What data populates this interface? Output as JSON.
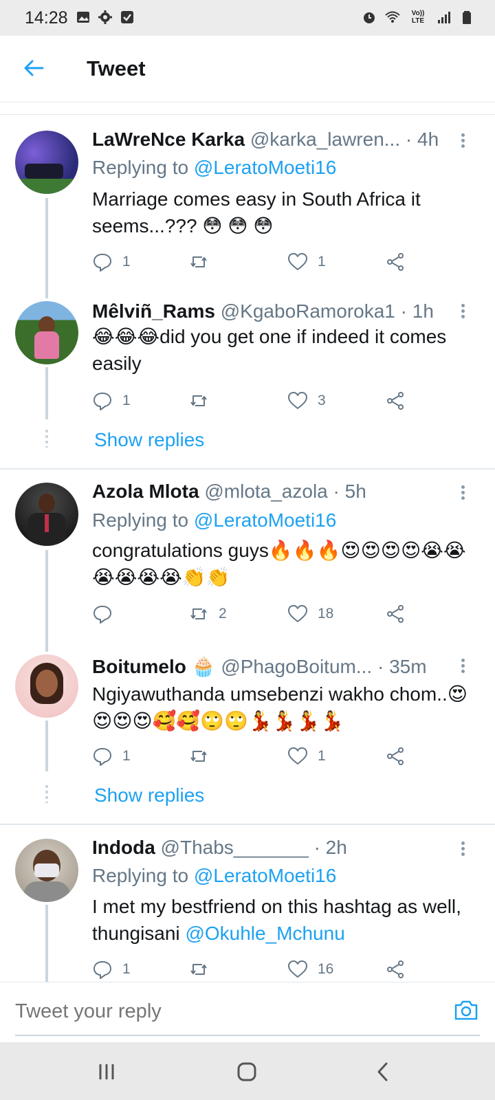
{
  "status_bar": {
    "time": "14:28",
    "network": "Vo)) LTE"
  },
  "app_bar": {
    "title": "Tweet"
  },
  "tweets": [
    {
      "name": "LaWreNce Karka",
      "handle": "@karka_lawren...",
      "time": "· 4h",
      "replying_prefix": "Replying to ",
      "replying_to": "@LeratoMoeti16",
      "text": "Marriage comes easy in South Africa it seems...??? 😳 😳 😳",
      "replies": "1",
      "retweets": "",
      "likes": "1"
    },
    {
      "name": "Mêlviñ_Rams",
      "handle": "@KgaboRamoroka1",
      "time": "· 1h",
      "text": "😂😂😂did  you get one if indeed it comes easily",
      "replies": "1",
      "retweets": "",
      "likes": "3",
      "show_replies": "Show replies"
    },
    {
      "name": "Azola Mlota",
      "handle": "@mlota_azola",
      "time": "· 5h",
      "replying_prefix": "Replying to ",
      "replying_to": "@LeratoMoeti16",
      "text": "congratulations guys🔥🔥🔥😍😍😍😍😭😭😭😭😭😭👏👏",
      "replies": "",
      "retweets": "2",
      "likes": "18"
    },
    {
      "name": "Boitumelo 🧁",
      "handle": "@PhagoBoitum...",
      "time": "· 35m",
      "text": "Ngiyawuthanda umsebenzi wakho chom..😍😍😍😍🥰🥰🙄🙄💃💃💃💃",
      "replies": "1",
      "retweets": "",
      "likes": "1",
      "show_replies": "Show replies"
    },
    {
      "name": "Indoda",
      "handle": "@Thabs_______",
      "time": "· 2h",
      "replying_prefix": "Replying to ",
      "replying_to": "@LeratoMoeti16",
      "text_prefix": "I met my bestfriend on this hashtag as well, thungisani ",
      "mention": "@Okuhle_Mchunu",
      "replies": "1",
      "retweets": "",
      "likes": "16"
    }
  ],
  "reply_bar": {
    "placeholder": "Tweet your reply"
  },
  "icons": {
    "back": "arrow-left-icon",
    "reply": "reply-icon",
    "retweet": "retweet-icon",
    "like": "heart-icon",
    "share": "share-icon",
    "more": "more-vertical-icon",
    "camera": "camera-icon"
  },
  "colors": {
    "accent": "#1da1f2",
    "secondary_text": "#657786",
    "divider": "#e1e8ed"
  }
}
